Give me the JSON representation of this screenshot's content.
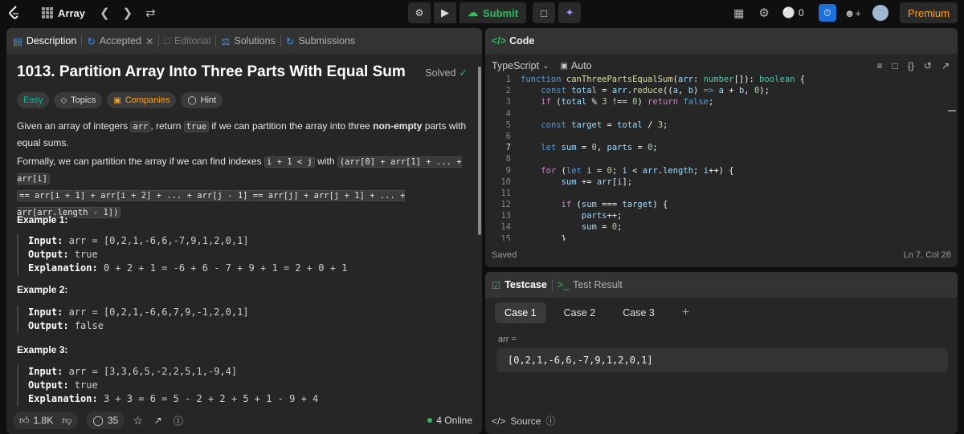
{
  "topbar": {
    "title": "Array",
    "submit_label": "Submit",
    "timer_count": "0",
    "premium_label": "Premium"
  },
  "desc_tabs": {
    "description": "Description",
    "accepted": "Accepted",
    "editorial": "Editorial",
    "solutions": "Solutions",
    "submissions": "Submissions"
  },
  "problem": {
    "title": "1013. Partition Array Into Three Parts With Equal Sum",
    "status": "Solved",
    "chips": [
      "Easy",
      "Topics",
      "Companies",
      "Hint"
    ],
    "p1_a": "Given an array of integers ",
    "p1_code1": "arr",
    "p1_b": ", return ",
    "p1_code2": "true",
    "p1_c": " if we can partition the array into three ",
    "p1_bold": "non-empty",
    "p1_d": " parts with equal sums.",
    "p2_a": "Formally, we can partition the array if we can find indexes ",
    "p2_code1": "i + 1 < j",
    "p2_b": " with ",
    "p2_code2": "(arr[0] + arr[1] + ... + arr[i]",
    "p2_code3": "== arr[i + 1] + arr[i + 2] + ... + arr[j - 1] == arr[j] + arr[j + 1] + ... + arr[arr.length - 1])",
    "examples": [
      {
        "heading": "Example 1:",
        "input": "arr = [0,2,1,-6,6,-7,9,1,2,0,1]",
        "output": "true",
        "explanation": "0 + 2 + 1 = -6 + 6 - 7 + 9 + 1 = 2 + 0 + 1"
      },
      {
        "heading": "Example 2:",
        "input": "arr = [0,2,1,-6,6,7,9,-1,2,0,1]",
        "output": "false"
      },
      {
        "heading": "Example 3:",
        "input": "arr = [3,3,6,5,-2,2,5,1,-9,4]",
        "output": "true",
        "explanation": "3 + 3 = 6 = 5 - 2 + 2 + 5 + 1 - 9 + 4"
      }
    ],
    "labels": {
      "input": "Input:",
      "output": "Output:",
      "explanation": "Explanation:"
    }
  },
  "desc_footer": {
    "likes": "1.8K",
    "comments": "35",
    "online": "4 Online"
  },
  "code_panel": {
    "header": "Code",
    "language": "TypeScript",
    "auto": "Auto",
    "saved": "Saved",
    "cursor": "Ln 7, Col 28"
  },
  "test_panel": {
    "testcase_tab": "Testcase",
    "result_tab": "Test Result",
    "cases": [
      "Case 1",
      "Case 2",
      "Case 3"
    ],
    "input_label": "arr =",
    "input_value": "[0,2,1,-6,6,-7,9,1,2,0,1]",
    "source": "Source"
  }
}
